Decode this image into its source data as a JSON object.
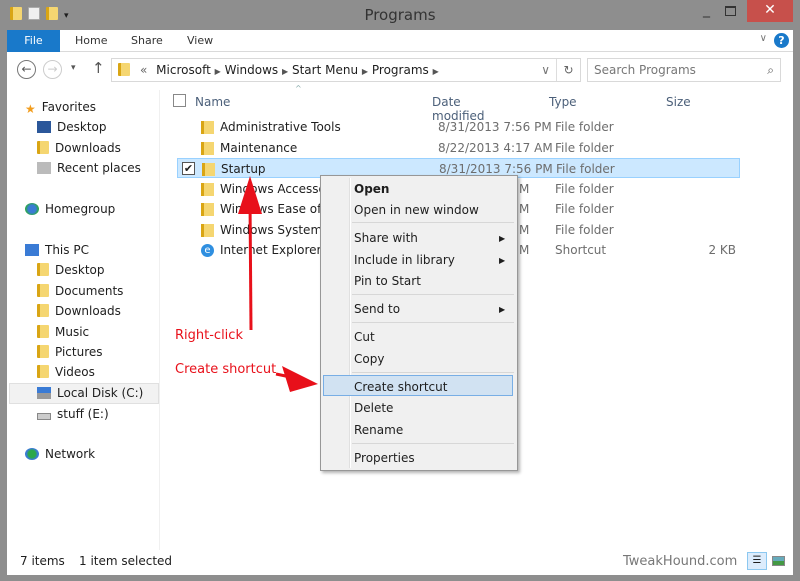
{
  "window": {
    "title": "Programs",
    "close_icon": "close-icon"
  },
  "ribbon": {
    "tabs": [
      "File",
      "Home",
      "Share",
      "View"
    ],
    "help": "?"
  },
  "address": {
    "path": [
      "Microsoft",
      "Windows",
      "Start Menu",
      "Programs"
    ],
    "overflow": "«",
    "search_placeholder": "Search Programs"
  },
  "sidebar": {
    "favorites": "Favorites",
    "fav_items": [
      "Desktop",
      "Downloads",
      "Recent places"
    ],
    "homegroup": "Homegroup",
    "thispc": "This PC",
    "pc_items": [
      "Desktop",
      "Documents",
      "Downloads",
      "Music",
      "Pictures",
      "Videos",
      "Local Disk (C:)",
      "stuff (E:)"
    ],
    "network": "Network"
  },
  "columns": {
    "name": "Name",
    "date": "Date modified",
    "type": "Type",
    "size": "Size"
  },
  "files": [
    {
      "name": "Administrative Tools",
      "date": "8/31/2013 7:56 PM",
      "type": "File folder",
      "size": ""
    },
    {
      "name": "Maintenance",
      "date": "8/22/2013 4:17 AM",
      "type": "File folder",
      "size": ""
    },
    {
      "name": "Startup",
      "date": "8/31/2013 7:56 PM",
      "type": "File folder",
      "size": "",
      "selected": true
    },
    {
      "name": "Windows Accessories",
      "date": "M",
      "type": "File folder",
      "size": ""
    },
    {
      "name": "Windows Ease of Access",
      "date": "M",
      "type": "File folder",
      "size": ""
    },
    {
      "name": "Windows System",
      "date": "M",
      "type": "File folder",
      "size": ""
    },
    {
      "name": "Internet Explorer",
      "date": "M",
      "type": "Shortcut",
      "size": "2 KB"
    }
  ],
  "context_menu": [
    {
      "label": "Open",
      "bold": true
    },
    {
      "label": "Open in new window"
    },
    {
      "label": "Share with",
      "submenu": true
    },
    {
      "label": "Include in library",
      "submenu": true
    },
    {
      "label": "Pin to Start"
    },
    {
      "label": "Send to",
      "submenu": true
    },
    {
      "label": "Cut"
    },
    {
      "label": "Copy"
    },
    {
      "label": "Create shortcut",
      "highlighted": true
    },
    {
      "label": "Delete"
    },
    {
      "label": "Rename"
    },
    {
      "label": "Properties"
    }
  ],
  "annotations": {
    "right_click": "Right-click",
    "create_shortcut": "Create shortcut",
    "color": "#e8101a"
  },
  "status": {
    "items": "7 items",
    "selected": "1 item selected",
    "watermark": "TweakHound.com"
  },
  "colors": {
    "accent": "#1979ca",
    "selection": "#cce8ff",
    "close": "#c7504b"
  }
}
